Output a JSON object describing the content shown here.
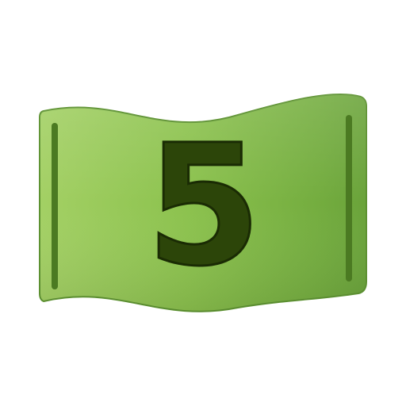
{
  "icon": {
    "name": "golf-hole-flag-icon",
    "number": "5"
  },
  "colors": {
    "background": "#ffffff",
    "flag_light": "#a3d064",
    "flag_mid": "#8cc24e",
    "flag_dark": "#6aa33a",
    "flag_edge": "#5d9231",
    "slot": "#4b7a22",
    "number_fill": "#2c4509",
    "number_outline": "#1a2b04"
  }
}
